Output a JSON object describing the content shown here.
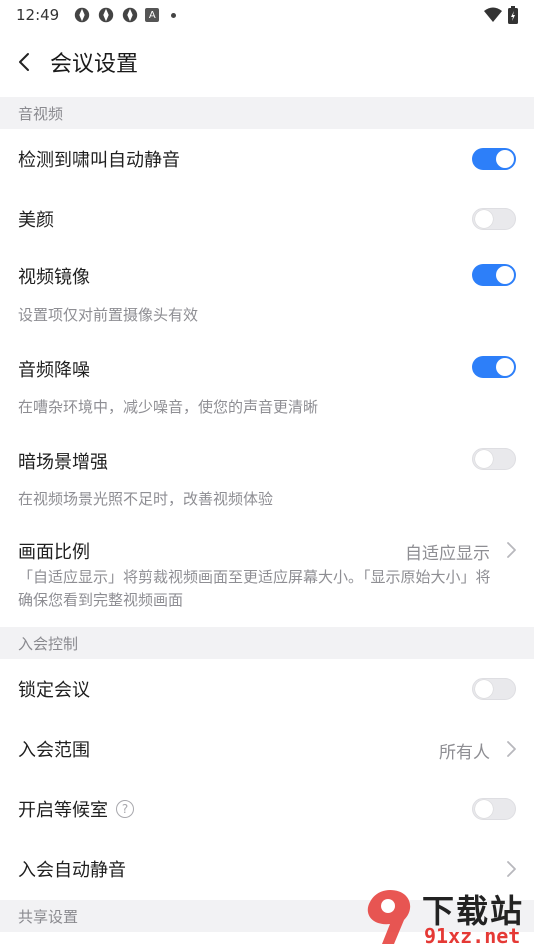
{
  "status_bar": {
    "time": "12:49",
    "badge": "A"
  },
  "header": {
    "title": "会议设置"
  },
  "sections": {
    "av": "音视频",
    "join": "入会控制",
    "share": "共享设置"
  },
  "rows": {
    "howl_mute": {
      "label": "检测到啸叫自动静音",
      "on": true
    },
    "beauty": {
      "label": "美颜",
      "on": false
    },
    "mirror": {
      "label": "视频镜像",
      "desc": "设置项仅对前置摄像头有效",
      "on": true
    },
    "noise": {
      "label": "音频降噪",
      "desc": "在嘈杂环境中，减少噪音，使您的声音更清晰",
      "on": true
    },
    "low_light": {
      "label": "暗场景增强",
      "desc": "在视频场景光照不足时，改善视频体验",
      "on": false
    },
    "ratio": {
      "label": "画面比例",
      "value": "自适应显示",
      "desc_line1": "「自适应显示」将剪裁视频画面至更适应屏幕大小。「显示原始大小」将",
      "desc_line2": "确保您看到完整视频画面"
    },
    "lock": {
      "label": "锁定会议",
      "on": false
    },
    "scope": {
      "label": "入会范围",
      "value": "所有人"
    },
    "waiting_room": {
      "label": "开启等候室",
      "help": "?",
      "on": false
    },
    "join_mute": {
      "label": "入会自动静音"
    }
  },
  "watermark": {
    "text_top": "下载站",
    "text_bottom": "91xz.net"
  },
  "colors": {
    "accent": "#2d7ff9",
    "section_bg": "#f2f2f4",
    "muted_text": "#8e8e93"
  }
}
